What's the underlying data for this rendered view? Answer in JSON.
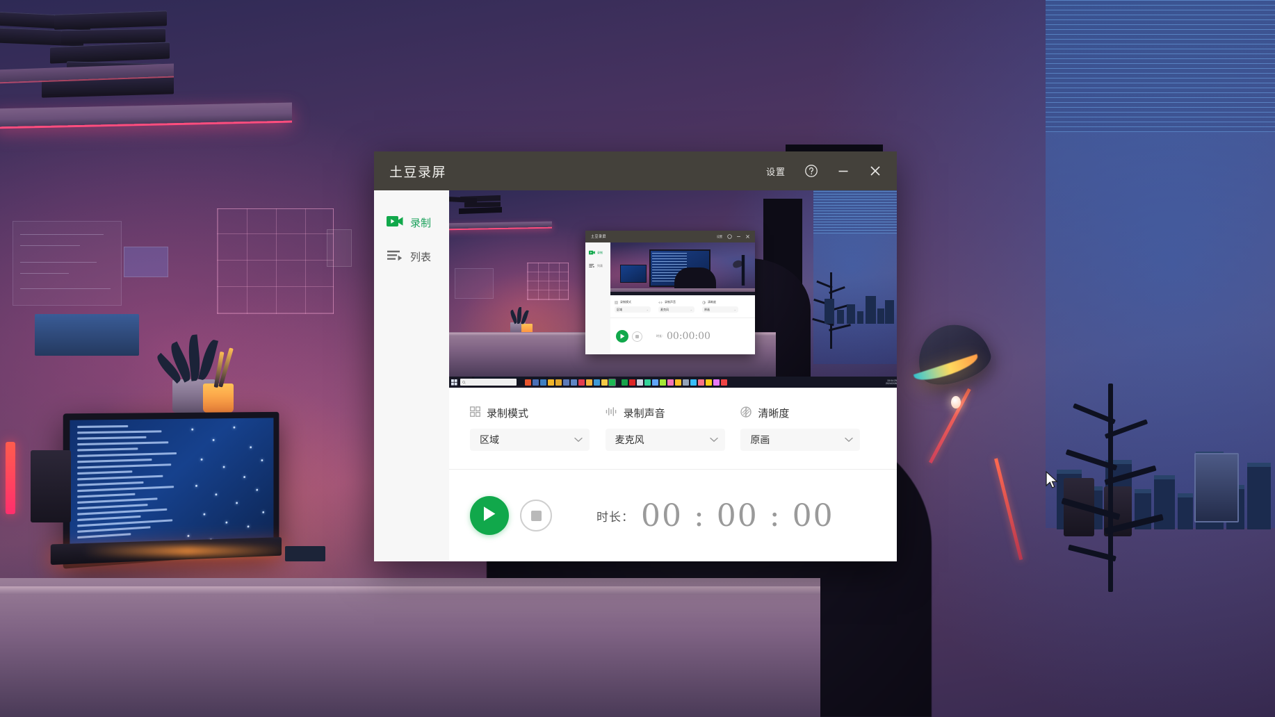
{
  "window": {
    "title": "土豆录屏",
    "titlebar": {
      "settings_label": "设置",
      "help_icon": "question-circle-icon",
      "minimize_icon": "minimize-icon",
      "close_icon": "close-icon"
    }
  },
  "sidebar": {
    "items": [
      {
        "label": "录制",
        "icon": "video-camera-icon",
        "active": true
      },
      {
        "label": "列表",
        "icon": "playlist-icon",
        "active": false
      }
    ]
  },
  "preview": {
    "name": "screen-preview",
    "description": "recursive desktop capture preview",
    "mini_window_title": "土豆录屏",
    "mini_settings_label": "设置",
    "mini_duration_value": "00:00:00",
    "mini_sidebar": [
      "录制",
      "列表"
    ],
    "mini_options": [
      "录制模式",
      "录制声音",
      "清晰度"
    ],
    "mini_option_values": [
      "区域",
      "麦克风",
      "原画"
    ]
  },
  "options": [
    {
      "icon": "grid-icon",
      "label": "录制模式",
      "value": "区域",
      "chevron": "chevron-down-icon"
    },
    {
      "icon": "audio-wave-icon",
      "label": "录制声音",
      "value": "麦克风",
      "chevron": "chevron-down-icon"
    },
    {
      "icon": "clarity-circle-icon",
      "label": "清晰度",
      "value": "原画",
      "chevron": "chevron-down-icon"
    }
  ],
  "transport": {
    "record_icon": "play-triangle-icon",
    "stop_icon": "stop-square-icon",
    "duration_label": "时长：",
    "duration_value": "00 : 00 : 00"
  },
  "colors": {
    "accent_green": "#11a84b",
    "titlebar": "#44413b",
    "sidebar_bg": "#f7f7f7",
    "select_bg": "#f7f7f7",
    "timer_text": "#9a9a9a"
  },
  "desktop": {
    "wallpaper": "neon purple workspace illustration",
    "cursor": "arrow-cursor"
  }
}
